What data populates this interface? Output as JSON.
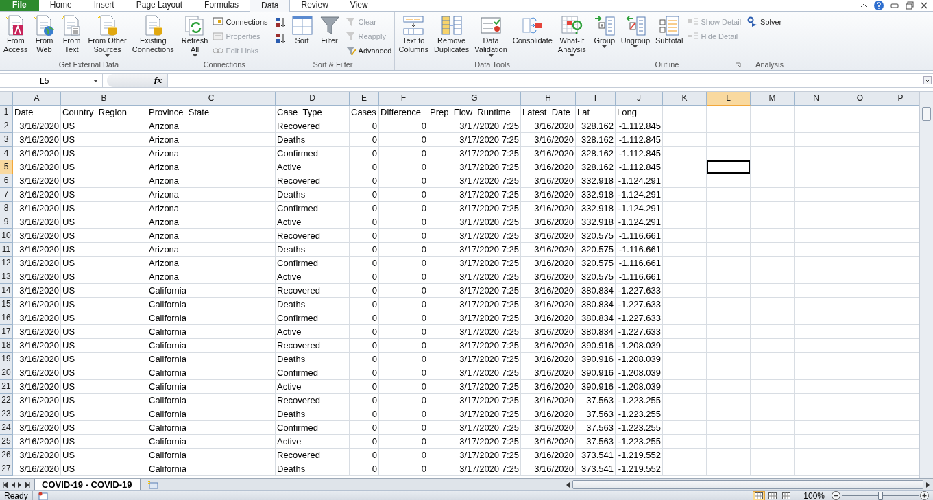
{
  "tabs": [
    {
      "label": "File",
      "kind": "file",
      "selected": false
    },
    {
      "label": "Home",
      "kind": "tab",
      "selected": false
    },
    {
      "label": "Insert",
      "kind": "tab",
      "selected": false
    },
    {
      "label": "Page Layout",
      "kind": "tab",
      "selected": false
    },
    {
      "label": "Formulas",
      "kind": "tab",
      "selected": false
    },
    {
      "label": "Data",
      "kind": "tab",
      "selected": true
    },
    {
      "label": "Review",
      "kind": "tab",
      "selected": false
    },
    {
      "label": "View",
      "kind": "tab",
      "selected": false
    }
  ],
  "ribbon": [
    {
      "label": "Get External Data",
      "launcher": false,
      "items": [
        {
          "kind": "large",
          "lines": [
            "From",
            "Access"
          ],
          "dropdown": false
        },
        {
          "kind": "large",
          "lines": [
            "From",
            "Web"
          ],
          "dropdown": false
        },
        {
          "kind": "large",
          "lines": [
            "From",
            "Text"
          ],
          "dropdown": false
        },
        {
          "kind": "large",
          "lines": [
            "From Other",
            "Sources"
          ],
          "dropdown": true
        },
        {
          "kind": "large",
          "lines": [
            "Existing",
            "Connections"
          ],
          "dropdown": false
        }
      ]
    },
    {
      "label": "Connections",
      "launcher": false,
      "items": [
        {
          "kind": "large",
          "lines": [
            "Refresh",
            "All"
          ],
          "dropdown": true
        },
        {
          "kind": "stack",
          "items": [
            {
              "label": "Connections",
              "disabled": false
            },
            {
              "label": "Properties",
              "disabled": true
            },
            {
              "label": "Edit Links",
              "disabled": true
            }
          ]
        }
      ]
    },
    {
      "label": "Sort & Filter",
      "launcher": false,
      "items": [
        {
          "kind": "iconstack"
        },
        {
          "kind": "large",
          "lines": [
            "Sort"
          ],
          "dropdown": false
        },
        {
          "kind": "large",
          "lines": [
            "Filter"
          ],
          "dropdown": false
        },
        {
          "kind": "stack",
          "items": [
            {
              "label": "Clear",
              "disabled": true
            },
            {
              "label": "Reapply",
              "disabled": true
            },
            {
              "label": "Advanced",
              "disabled": false
            }
          ]
        }
      ]
    },
    {
      "label": "Data Tools",
      "launcher": false,
      "items": [
        {
          "kind": "large",
          "lines": [
            "Text to",
            "Columns"
          ],
          "dropdown": false
        },
        {
          "kind": "large",
          "lines": [
            "Remove",
            "Duplicates"
          ],
          "dropdown": false
        },
        {
          "kind": "large",
          "lines": [
            "Data",
            "Validation"
          ],
          "dropdown": true
        },
        {
          "kind": "large",
          "lines": [
            "Consolidate"
          ],
          "dropdown": false
        },
        {
          "kind": "large",
          "lines": [
            "What-If",
            "Analysis"
          ],
          "dropdown": true
        }
      ]
    },
    {
      "label": "Outline",
      "launcher": true,
      "items": [
        {
          "kind": "large",
          "lines": [
            "Group"
          ],
          "dropdown": true
        },
        {
          "kind": "large",
          "lines": [
            "Ungroup"
          ],
          "dropdown": true
        },
        {
          "kind": "large",
          "lines": [
            "Subtotal"
          ],
          "dropdown": false
        },
        {
          "kind": "stack",
          "items": [
            {
              "label": "Show Detail",
              "disabled": true
            },
            {
              "label": "Hide Detail",
              "disabled": true
            }
          ]
        }
      ]
    },
    {
      "label": "Analysis",
      "launcher": false,
      "items": [
        {
          "kind": "stack",
          "items": [
            {
              "label": "Solver",
              "disabled": false
            }
          ]
        }
      ]
    }
  ],
  "name_box": "L5",
  "function_button": "fx",
  "columns": [
    {
      "label": "A",
      "selected": false
    },
    {
      "label": "B",
      "selected": false
    },
    {
      "label": "C",
      "selected": false
    },
    {
      "label": "D",
      "selected": false
    },
    {
      "label": "E",
      "selected": false
    },
    {
      "label": "F",
      "selected": false
    },
    {
      "label": "G",
      "selected": false
    },
    {
      "label": "H",
      "selected": false
    },
    {
      "label": "I",
      "selected": false
    },
    {
      "label": "J",
      "selected": false
    },
    {
      "label": "K",
      "selected": false
    },
    {
      "label": "L",
      "selected": true
    },
    {
      "label": "M",
      "selected": false
    },
    {
      "label": "N",
      "selected": false
    },
    {
      "label": "O",
      "selected": false
    },
    {
      "label": "P",
      "selected": false
    }
  ],
  "rows": [
    {
      "number": "1",
      "selected": false,
      "cells": [
        "Date",
        "Country_Region",
        "Province_State",
        "Case_Type",
        "Cases",
        "Difference",
        "Prep_Flow_Runtime",
        "Latest_Date",
        "Lat",
        "Long"
      ]
    },
    {
      "number": "2",
      "selected": false,
      "cells": [
        "3/16/2020",
        "US",
        "Arizona",
        "Recovered",
        "0",
        "0",
        "3/17/2020 7:25",
        "3/16/2020",
        "328.162",
        "-1.112.845"
      ]
    },
    {
      "number": "3",
      "selected": false,
      "cells": [
        "3/16/2020",
        "US",
        "Arizona",
        "Deaths",
        "0",
        "0",
        "3/17/2020 7:25",
        "3/16/2020",
        "328.162",
        "-1.112.845"
      ]
    },
    {
      "number": "4",
      "selected": false,
      "cells": [
        "3/16/2020",
        "US",
        "Arizona",
        "Confirmed",
        "0",
        "0",
        "3/17/2020 7:25",
        "3/16/2020",
        "328.162",
        "-1.112.845"
      ]
    },
    {
      "number": "5",
      "selected": true,
      "cells": [
        "3/16/2020",
        "US",
        "Arizona",
        "Active",
        "0",
        "0",
        "3/17/2020 7:25",
        "3/16/2020",
        "328.162",
        "-1.112.845"
      ]
    },
    {
      "number": "6",
      "selected": false,
      "cells": [
        "3/16/2020",
        "US",
        "Arizona",
        "Recovered",
        "0",
        "0",
        "3/17/2020 7:25",
        "3/16/2020",
        "332.918",
        "-1.124.291"
      ]
    },
    {
      "number": "7",
      "selected": false,
      "cells": [
        "3/16/2020",
        "US",
        "Arizona",
        "Deaths",
        "0",
        "0",
        "3/17/2020 7:25",
        "3/16/2020",
        "332.918",
        "-1.124.291"
      ]
    },
    {
      "number": "8",
      "selected": false,
      "cells": [
        "3/16/2020",
        "US",
        "Arizona",
        "Confirmed",
        "0",
        "0",
        "3/17/2020 7:25",
        "3/16/2020",
        "332.918",
        "-1.124.291"
      ]
    },
    {
      "number": "9",
      "selected": false,
      "cells": [
        "3/16/2020",
        "US",
        "Arizona",
        "Active",
        "0",
        "0",
        "3/17/2020 7:25",
        "3/16/2020",
        "332.918",
        "-1.124.291"
      ]
    },
    {
      "number": "10",
      "selected": false,
      "cells": [
        "3/16/2020",
        "US",
        "Arizona",
        "Recovered",
        "0",
        "0",
        "3/17/2020 7:25",
        "3/16/2020",
        "320.575",
        "-1.116.661"
      ]
    },
    {
      "number": "11",
      "selected": false,
      "cells": [
        "3/16/2020",
        "US",
        "Arizona",
        "Deaths",
        "0",
        "0",
        "3/17/2020 7:25",
        "3/16/2020",
        "320.575",
        "-1.116.661"
      ]
    },
    {
      "number": "12",
      "selected": false,
      "cells": [
        "3/16/2020",
        "US",
        "Arizona",
        "Confirmed",
        "0",
        "0",
        "3/17/2020 7:25",
        "3/16/2020",
        "320.575",
        "-1.116.661"
      ]
    },
    {
      "number": "13",
      "selected": false,
      "cells": [
        "3/16/2020",
        "US",
        "Arizona",
        "Active",
        "0",
        "0",
        "3/17/2020 7:25",
        "3/16/2020",
        "320.575",
        "-1.116.661"
      ]
    },
    {
      "number": "14",
      "selected": false,
      "cells": [
        "3/16/2020",
        "US",
        "California",
        "Recovered",
        "0",
        "0",
        "3/17/2020 7:25",
        "3/16/2020",
        "380.834",
        "-1.227.633"
      ]
    },
    {
      "number": "15",
      "selected": false,
      "cells": [
        "3/16/2020",
        "US",
        "California",
        "Deaths",
        "0",
        "0",
        "3/17/2020 7:25",
        "3/16/2020",
        "380.834",
        "-1.227.633"
      ]
    },
    {
      "number": "16",
      "selected": false,
      "cells": [
        "3/16/2020",
        "US",
        "California",
        "Confirmed",
        "0",
        "0",
        "3/17/2020 7:25",
        "3/16/2020",
        "380.834",
        "-1.227.633"
      ]
    },
    {
      "number": "17",
      "selected": false,
      "cells": [
        "3/16/2020",
        "US",
        "California",
        "Active",
        "0",
        "0",
        "3/17/2020 7:25",
        "3/16/2020",
        "380.834",
        "-1.227.633"
      ]
    },
    {
      "number": "18",
      "selected": false,
      "cells": [
        "3/16/2020",
        "US",
        "California",
        "Recovered",
        "0",
        "0",
        "3/17/2020 7:25",
        "3/16/2020",
        "390.916",
        "-1.208.039"
      ]
    },
    {
      "number": "19",
      "selected": false,
      "cells": [
        "3/16/2020",
        "US",
        "California",
        "Deaths",
        "0",
        "0",
        "3/17/2020 7:25",
        "3/16/2020",
        "390.916",
        "-1.208.039"
      ]
    },
    {
      "number": "20",
      "selected": false,
      "cells": [
        "3/16/2020",
        "US",
        "California",
        "Confirmed",
        "0",
        "0",
        "3/17/2020 7:25",
        "3/16/2020",
        "390.916",
        "-1.208.039"
      ]
    },
    {
      "number": "21",
      "selected": false,
      "cells": [
        "3/16/2020",
        "US",
        "California",
        "Active",
        "0",
        "0",
        "3/17/2020 7:25",
        "3/16/2020",
        "390.916",
        "-1.208.039"
      ]
    },
    {
      "number": "22",
      "selected": false,
      "cells": [
        "3/16/2020",
        "US",
        "California",
        "Recovered",
        "0",
        "0",
        "3/17/2020 7:25",
        "3/16/2020",
        "37.563",
        "-1.223.255"
      ]
    },
    {
      "number": "23",
      "selected": false,
      "cells": [
        "3/16/2020",
        "US",
        "California",
        "Deaths",
        "0",
        "0",
        "3/17/2020 7:25",
        "3/16/2020",
        "37.563",
        "-1.223.255"
      ]
    },
    {
      "number": "24",
      "selected": false,
      "cells": [
        "3/16/2020",
        "US",
        "California",
        "Confirmed",
        "0",
        "0",
        "3/17/2020 7:25",
        "3/16/2020",
        "37.563",
        "-1.223.255"
      ]
    },
    {
      "number": "25",
      "selected": false,
      "cells": [
        "3/16/2020",
        "US",
        "California",
        "Active",
        "0",
        "0",
        "3/17/2020 7:25",
        "3/16/2020",
        "37.563",
        "-1.223.255"
      ]
    },
    {
      "number": "26",
      "selected": false,
      "cells": [
        "3/16/2020",
        "US",
        "California",
        "Recovered",
        "0",
        "0",
        "3/17/2020 7:25",
        "3/16/2020",
        "373.541",
        "-1.219.552"
      ]
    },
    {
      "number": "27",
      "selected": false,
      "cells": [
        "3/16/2020",
        "US",
        "California",
        "Deaths",
        "0",
        "0",
        "3/17/2020 7:25",
        "3/16/2020",
        "373.541",
        "-1.219.552"
      ]
    }
  ],
  "sheet_tabs": [
    {
      "label": "COVID-19 - COVID-19",
      "selected": true
    }
  ],
  "status_bar": {
    "text": "Ready",
    "views": [
      {
        "selected": true
      },
      {
        "selected": false
      },
      {
        "selected": false
      }
    ],
    "zoom": "100%",
    "zoom_level": {
      "level": 0.5
    }
  }
}
